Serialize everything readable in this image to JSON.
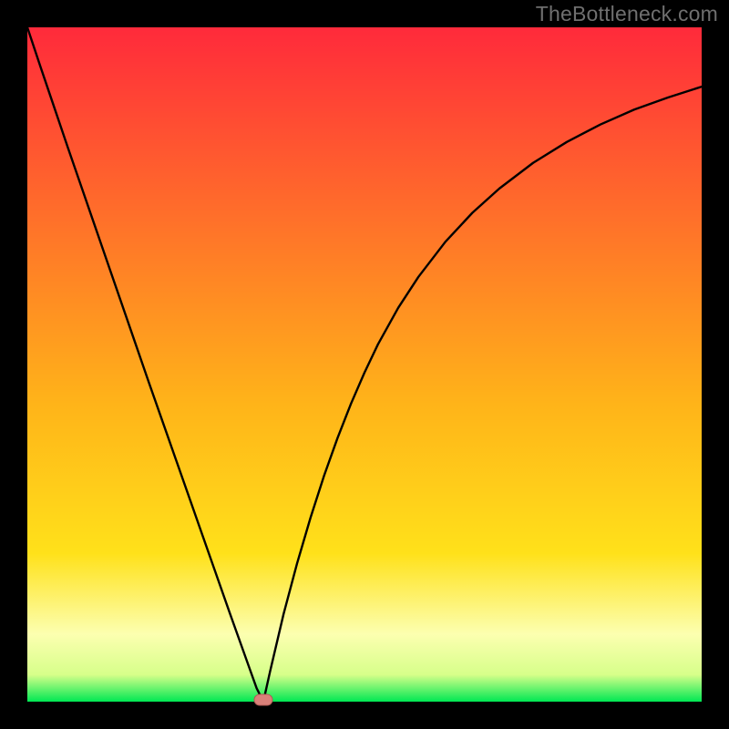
{
  "attribution": "TheBottleneck.com",
  "colors": {
    "gradient_top": "#ff2a3b",
    "gradient_yellow": "#ffe11a",
    "gradient_pale": "#fcffb0",
    "gradient_green": "#00e853",
    "curve": "#000000",
    "marker_fill": "#d98079",
    "marker_stroke": "#b05a54",
    "frame": "#000000"
  },
  "chart_data": {
    "type": "line",
    "title": "",
    "xlabel": "",
    "ylabel": "",
    "xlim": [
      0,
      100
    ],
    "ylim": [
      0,
      100
    ],
    "x": [
      0,
      2,
      4,
      6,
      8,
      10,
      12,
      14,
      16,
      18,
      20,
      22,
      24,
      26,
      28,
      30,
      32,
      33,
      34,
      35,
      36,
      38,
      40,
      42,
      44,
      46,
      48,
      50,
      52,
      55,
      58,
      62,
      66,
      70,
      75,
      80,
      85,
      90,
      95,
      100
    ],
    "series": [
      {
        "name": "bottleneck_curve",
        "values": [
          100,
          94,
          88.1,
          82.2,
          76.4,
          70.6,
          64.8,
          59,
          53.2,
          47.4,
          41.7,
          36,
          30.3,
          24.6,
          18.9,
          13.2,
          7.6,
          4.8,
          2,
          0,
          4.5,
          13,
          20.5,
          27.3,
          33.5,
          39.1,
          44.2,
          48.8,
          53,
          58.4,
          63,
          68.2,
          72.5,
          76.1,
          79.9,
          83,
          85.6,
          87.8,
          89.6,
          91.2
        ]
      }
    ],
    "marker": {
      "x": 35,
      "y": 0
    },
    "annotations": []
  }
}
